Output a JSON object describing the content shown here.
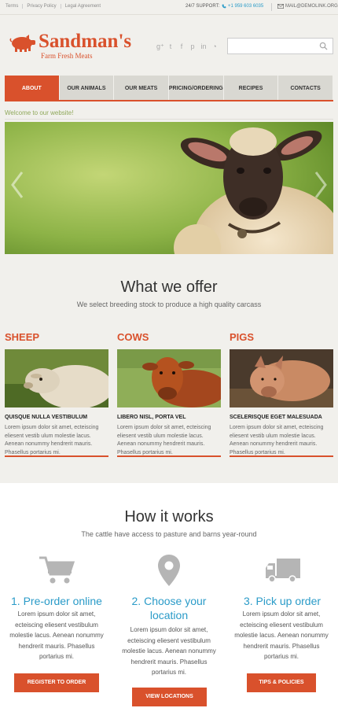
{
  "topbar": {
    "links": [
      "Terms",
      "Privacy Policy",
      "Legal Agreement"
    ],
    "support_label": "24/7 SUPPORT:",
    "phone": "+1 959 603 6035",
    "mail": "MAIL@DEMOLINK.ORG"
  },
  "logo": {
    "name": "Sandman's",
    "tagline": "Farm Fresh Meats"
  },
  "social_icons": [
    "google-plus-icon",
    "twitter-icon",
    "facebook-icon",
    "pinterest-icon",
    "linkedin-icon",
    "rss-icon"
  ],
  "search": {
    "placeholder": "",
    "value": ""
  },
  "nav": {
    "tabs": [
      "About",
      "Our Animals",
      "Our Meats",
      "Pricing/Ordering",
      "Recipes",
      "Contacts"
    ],
    "active": "About"
  },
  "welcome": "Welcome to our website!",
  "offer": {
    "title": "What we offer",
    "subtitle": "We select breeding stock to produce a high quality carcass",
    "items": [
      {
        "heading": "Sheep",
        "sub": "Quisque nulla vestibulum",
        "body": "Lorem ipsum dolor sit amet, ecteiscing eliesent vestib ulum molestie lacus. Aenean nonummy hendrerit mauris. Phasellus portarius mi."
      },
      {
        "heading": "Cows",
        "sub": "Libero nisl, porta vel",
        "body": "Lorem ipsum dolor sit amet, ecteiscing eliesent vestib ulum molestie lacus. Aenean nonummy hendrerit mauris. Phasellus portarius mi."
      },
      {
        "heading": "Pigs",
        "sub": "Scelerisque eget malesuada",
        "body": "Lorem ipsum dolor sit amet, ecteiscing eliesent vestib ulum molestie lacus. Aenean nonummy hendrerit mauris. Phasellus portarius mi."
      }
    ]
  },
  "how": {
    "title": "How it works",
    "subtitle": "The cattle have access to pasture and barns year-round",
    "steps": [
      {
        "title": "1. Pre-order online",
        "body": "Lorem ipsum dolor sit amet, ecteiscing eliesent vestibulum molestie lacus. Aenean nonummy hendrerit mauris. Phasellus portarius mi.",
        "button": "Register to order"
      },
      {
        "title": "2. Choose your location",
        "body": "Lorem ipsum dolor sit amet, ecteiscing eliesent vestibulum molestie lacus. Aenean nonummy hendrerit mauris. Phasellus portarius mi.",
        "button": "View locations"
      },
      {
        "title": "3. Pick up order",
        "body": "Lorem ipsum dolor sit amet, ecteiscing eliesent vestibulum molestie lacus. Aenean nonummy hendrerit mauris. Phasellus portarius mi.",
        "button": "Tips & policies"
      }
    ]
  },
  "colors": {
    "accent": "#d9512c",
    "link": "#2a9bc8",
    "background": "#f1f0ec"
  }
}
